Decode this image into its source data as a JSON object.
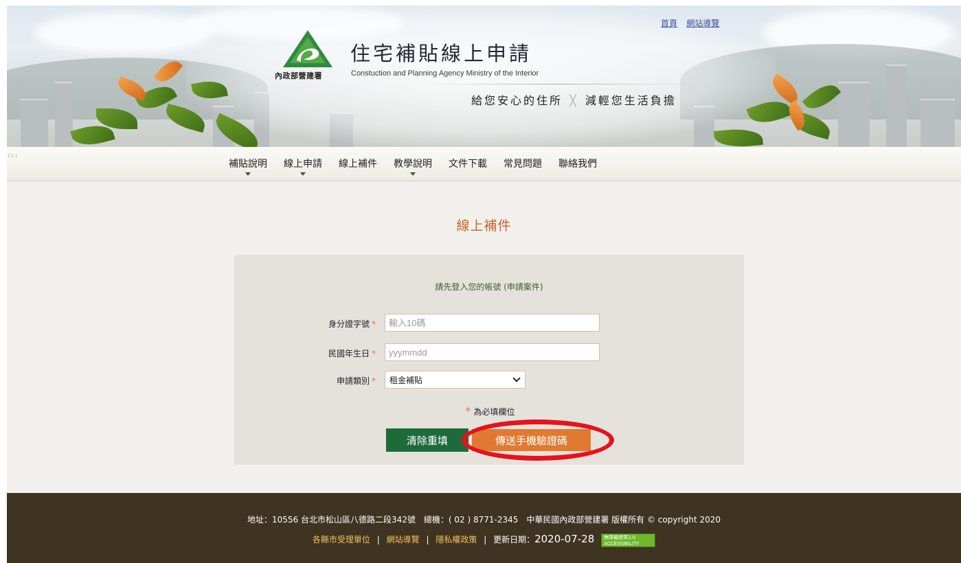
{
  "header": {
    "top_links": [
      "首頁",
      "網站導覽"
    ],
    "logo_org": "內政部營建署",
    "title": "住宅補貼線上申請",
    "subtitle_en": "Constuction and Planning Agency Ministry of the Interior",
    "slogan_left": "給您安心的住所",
    "slogan_sep": "╳",
    "slogan_right": "減輕您生活負擔"
  },
  "nav": {
    "items": [
      {
        "label": "補貼說明",
        "has_dropdown": true
      },
      {
        "label": "線上申請",
        "has_dropdown": true
      },
      {
        "label": "線上補件",
        "has_dropdown": false
      },
      {
        "label": "教學說明",
        "has_dropdown": true
      },
      {
        "label": "文件下載",
        "has_dropdown": false
      },
      {
        "label": "常見問題",
        "has_dropdown": false
      },
      {
        "label": "聯絡我們",
        "has_dropdown": false
      }
    ],
    "skip_marker": ":::"
  },
  "main": {
    "heading": "線上補件",
    "intro": "請先登入您的帳號 (申請案件)",
    "fields": {
      "id_label": "身分證字號",
      "id_placeholder": "輸入10碼",
      "birth_label": "民國年生日",
      "birth_placeholder": "yyymmdd",
      "type_label": "申請類別",
      "type_value": "租金補貼"
    },
    "required_mark": "*",
    "required_note": "為必填欄位",
    "reset_button": "清除重填",
    "send_button": "傳送手機驗證碼"
  },
  "footer": {
    "line1": "地址：10556 台北市松山區八德路二段342號　總機：( 02 ) 8771-2345　中華民國內政部營建署 版權所有 © copyright 2020",
    "link_units": "各縣市受理單位",
    "link_sitemap": "網站導覽",
    "link_privacy": "隱私權政策",
    "separator": "|",
    "updated_label": "更新日期：",
    "updated_date": "2020-07-28",
    "a11y_badge": "無障礙標章2.0 ACCESSIBILITY"
  },
  "colors": {
    "accent_orange": "#e07a30",
    "heading_orange": "#c8642a",
    "reset_green": "#1f6a3a",
    "footer_brown": "#3f3321",
    "highlight_red": "#e6121d"
  }
}
